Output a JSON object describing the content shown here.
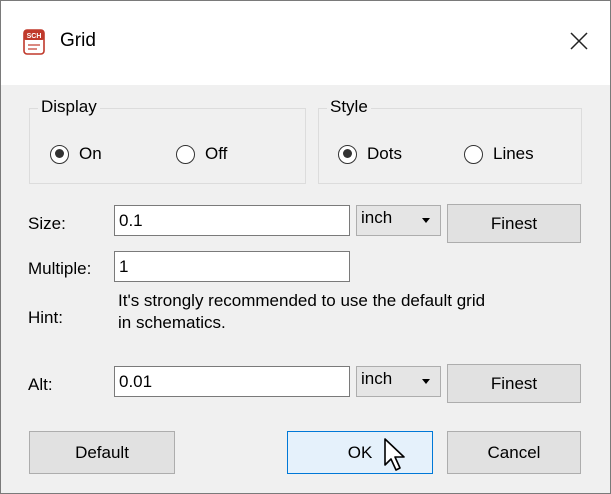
{
  "window": {
    "title": "Grid",
    "app_icon": "sch-icon",
    "app_icon_text": "SCH",
    "close_icon": "close-icon"
  },
  "display": {
    "label": "Display",
    "options": [
      {
        "label": "On",
        "checked": true
      },
      {
        "label": "Off",
        "checked": false
      }
    ]
  },
  "style": {
    "label": "Style",
    "options": [
      {
        "label": "Dots",
        "checked": true
      },
      {
        "label": "Lines",
        "checked": false
      }
    ]
  },
  "size": {
    "label": "Size:",
    "value": "0.1",
    "unit": "inch",
    "finest_label": "Finest"
  },
  "multiple": {
    "label": "Multiple:",
    "value": "1"
  },
  "hint": {
    "label": "Hint:",
    "line1": "It's strongly recommended to use the default grid",
    "line2": "in schematics."
  },
  "alt": {
    "label": "Alt:",
    "value": "0.01",
    "unit": "inch",
    "finest_label": "Finest"
  },
  "buttons": {
    "default": "Default",
    "ok": "OK",
    "cancel": "Cancel"
  },
  "colors": {
    "dialog_bg": "#f0f0f0",
    "title_bg": "#ffffff",
    "ok_border": "#0078d7",
    "ok_bg": "#e5f1fb"
  }
}
